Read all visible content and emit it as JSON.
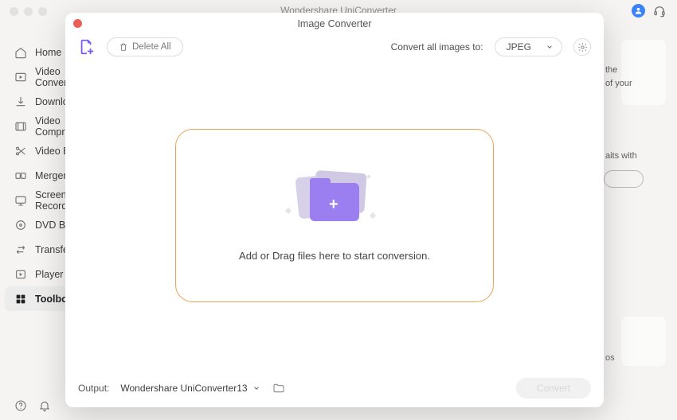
{
  "app": {
    "title": "Wondershare UniConverter"
  },
  "sidebar": {
    "items": [
      {
        "label": "Home"
      },
      {
        "label": "Video Converter"
      },
      {
        "label": "Downloader"
      },
      {
        "label": "Video Compressor"
      },
      {
        "label": "Video Editor"
      },
      {
        "label": "Merger"
      },
      {
        "label": "Screen Recorder"
      },
      {
        "label": "DVD Burner"
      },
      {
        "label": "Transfer"
      },
      {
        "label": "Player"
      },
      {
        "label": "Toolbox"
      }
    ]
  },
  "background": {
    "hint1a": "the",
    "hint1b": "of your",
    "hint2": "aits with",
    "hint3": "os"
  },
  "modal": {
    "title": "Image Converter",
    "delete_all": "Delete All",
    "convert_label": "Convert all images to:",
    "format_selected": "JPEG",
    "drop_text": "Add or Drag files here to start conversion.",
    "output_label": "Output:",
    "output_path": "Wondershare UniConverter13",
    "convert_btn": "Convert"
  }
}
